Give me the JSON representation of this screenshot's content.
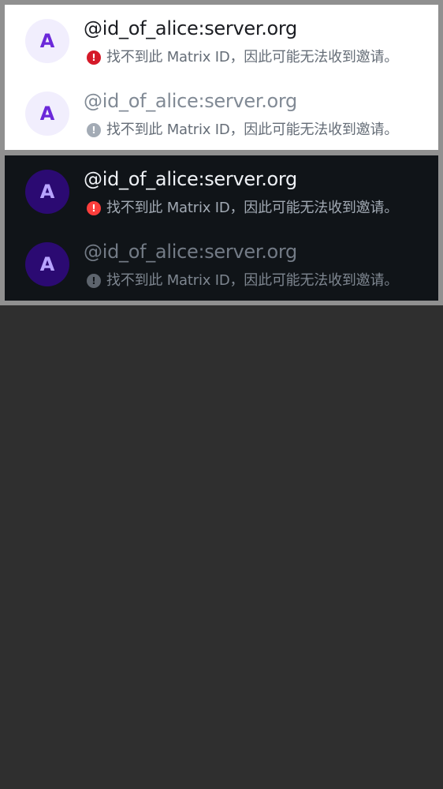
{
  "light": {
    "rows": [
      {
        "avatar_letter": "A",
        "user_id": "@id_of_alice:server.org",
        "warning_icon": "!",
        "warning": "找不到此 Matrix ID，因此可能无法收到邀请。"
      },
      {
        "avatar_letter": "A",
        "user_id": "@id_of_alice:server.org",
        "warning_icon": "!",
        "warning": "找不到此 Matrix ID，因此可能无法收到邀请。"
      }
    ]
  },
  "dark": {
    "rows": [
      {
        "avatar_letter": "A",
        "user_id": "@id_of_alice:server.org",
        "warning_icon": "!",
        "warning": "找不到此 Matrix ID，因此可能无法收到邀请。"
      },
      {
        "avatar_letter": "A",
        "user_id": "@id_of_alice:server.org",
        "warning_icon": "!",
        "warning": "找不到此 Matrix ID，因此可能无法收到邀请。"
      }
    ]
  },
  "colors": {
    "light_background": "#ffffff",
    "dark_background": "#101418",
    "error_light": "#d51928",
    "error_dark": "#fd3e3c",
    "avatar_accent": "#6b28d9",
    "outer_background": "#2f2f2f"
  },
  "icons": {
    "warning": "error-circle-icon"
  }
}
